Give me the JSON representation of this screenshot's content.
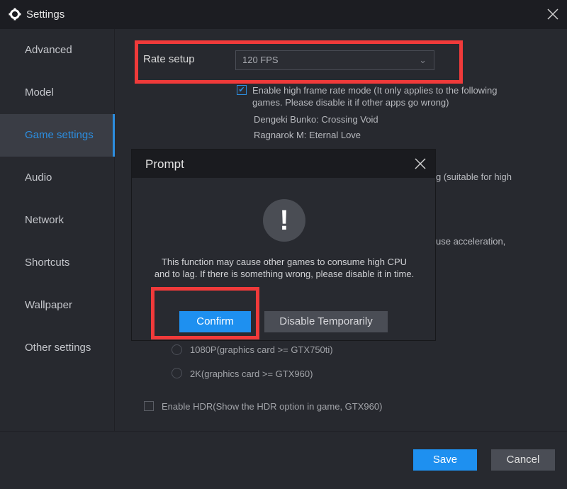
{
  "window": {
    "title": "Settings"
  },
  "sidebar": {
    "items": [
      {
        "label": "Advanced"
      },
      {
        "label": "Model"
      },
      {
        "label": "Game settings",
        "active": true
      },
      {
        "label": "Audio"
      },
      {
        "label": "Network"
      },
      {
        "label": "Shortcuts"
      },
      {
        "label": "Wallpaper"
      },
      {
        "label": "Other settings"
      }
    ]
  },
  "game": {
    "rate_label": "Rate setup",
    "rate_value": "120 FPS",
    "high_fps_checked": true,
    "high_fps_line1": "Enable high frame rate mode  (It only applies to the following",
    "high_fps_line2": "games. Please disable it if other apps go wrong)",
    "games": [
      "Dengeki Bunko: Crossing Void",
      "Ragnarok M: Eternal Love"
    ],
    "fragment1": "g  (suitable for high",
    "fragment2": "use acceleration,",
    "res_1080": "1080P(graphics card >= GTX750ti)",
    "res_2k": "2K(graphics card >= GTX960)",
    "hdr_checked": false,
    "hdr_label": "Enable HDR(Show the HDR option in game, GTX960)"
  },
  "dialog": {
    "title": "Prompt",
    "icon": "!",
    "message": "This function may cause other games to consume high CPU and to lag. If there is something wrong, please disable it in time.",
    "confirm": "Confirm",
    "disable": "Disable Temporarily"
  },
  "footer": {
    "save": "Save",
    "cancel": "Cancel"
  },
  "colors": {
    "accent": "#1e90f0",
    "highlight": "#f03a3a",
    "background": "#27292f"
  }
}
